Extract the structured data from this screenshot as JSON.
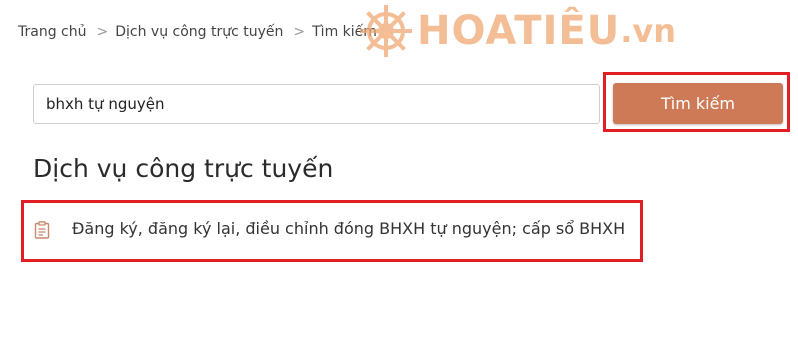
{
  "breadcrumb": {
    "items": [
      "Trang chủ",
      "Dịch vụ công trực tuyến",
      "Tìm kiếm"
    ],
    "separator": ">"
  },
  "logo": {
    "name": "HOATIÊU",
    "tld": ".vn",
    "icon": "ship-wheel-icon",
    "color": "#f0a772"
  },
  "search": {
    "value": "bhxh tự nguyện",
    "button_label": "Tìm kiếm"
  },
  "section": {
    "title": "Dịch vụ công trực tuyến"
  },
  "results": [
    {
      "label": "Đăng ký, đăng ký lại, điều chỉnh đóng BHXH tự nguyện; cấp sổ BHXH",
      "icon": "document-icon"
    }
  ],
  "colors": {
    "accent": "#cf7a56",
    "highlight": "#e21e25",
    "icon": "#c98a6c"
  }
}
